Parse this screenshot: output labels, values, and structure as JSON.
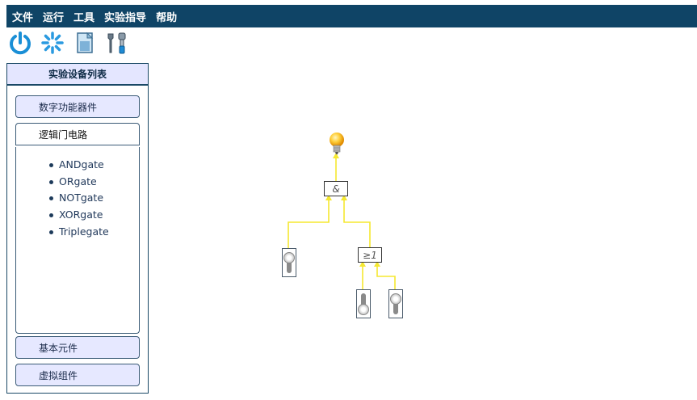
{
  "menu": [
    "文件",
    "运行",
    "工具",
    "实验指导",
    "帮助"
  ],
  "toolbar": {
    "icons": [
      "power-icon",
      "loading-spinner-icon",
      "document-icon",
      "tools-icon"
    ]
  },
  "sidebar": {
    "title": "实验设备列表",
    "categories": [
      {
        "label": "数字功能器件"
      },
      {
        "label": "逻辑门电路"
      },
      {
        "label": "基本元件"
      },
      {
        "label": "虚拟组件"
      }
    ],
    "expanded_items": [
      "ANDgate",
      "ORgate",
      "NOTgate",
      "XORgate",
      "Triplegate"
    ]
  },
  "circuit": {
    "and_gate_label": "&",
    "or_gate_label": "≥1",
    "wire_color": "#f5e830",
    "switch_states": [
      "up",
      "down",
      "up"
    ]
  }
}
